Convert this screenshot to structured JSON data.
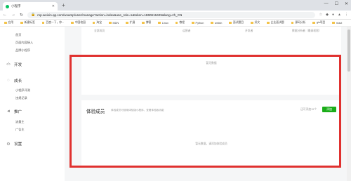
{
  "browser": {
    "tab_title": "小程序",
    "url": "mp.weixin.qq.com/wxamp/user/manage?action=index&use_role=1&token=1860616425&lang=zh_CN",
    "bookmarks": [
      "应用",
      "新建标签",
      "百度一下，你...",
      "中国校园",
      "淘宝",
      "MDN",
      "扩展",
      "博客",
      "Linux",
      "教程",
      "Python",
      "weixin",
      "面试题目",
      "好文",
      "企业面试题",
      "源码分析",
      "gis项目",
      "react"
    ]
  },
  "sidebar": {
    "items_top": [
      "首页",
      "页面内容接入",
      "品牌小程序"
    ],
    "sections": [
      {
        "label": "开发",
        "items": []
      },
      {
        "label": "成长",
        "items": [
          "小程序评测",
          "违规记录"
        ]
      },
      {
        "label": "推广",
        "items": [
          "流量主",
          "广告主"
        ]
      },
      {
        "label": "设置",
        "items": []
      }
    ]
  },
  "members_table": {
    "columns": [
      "全部成员",
      "运营者",
      "开发者",
      "数据分析者（最高权限）"
    ],
    "empty_text": "暂无数据"
  },
  "experience_members": {
    "title": "体验成员",
    "description": "体验成员可使用体验版小程序，查看体验版功能",
    "count_text": "还可添加15个",
    "add_button": "添加",
    "empty_text": "暂无数据，请添加体验成员"
  },
  "colors": {
    "accent_green": "#1aad19",
    "annotation_red": "#e0312f"
  }
}
